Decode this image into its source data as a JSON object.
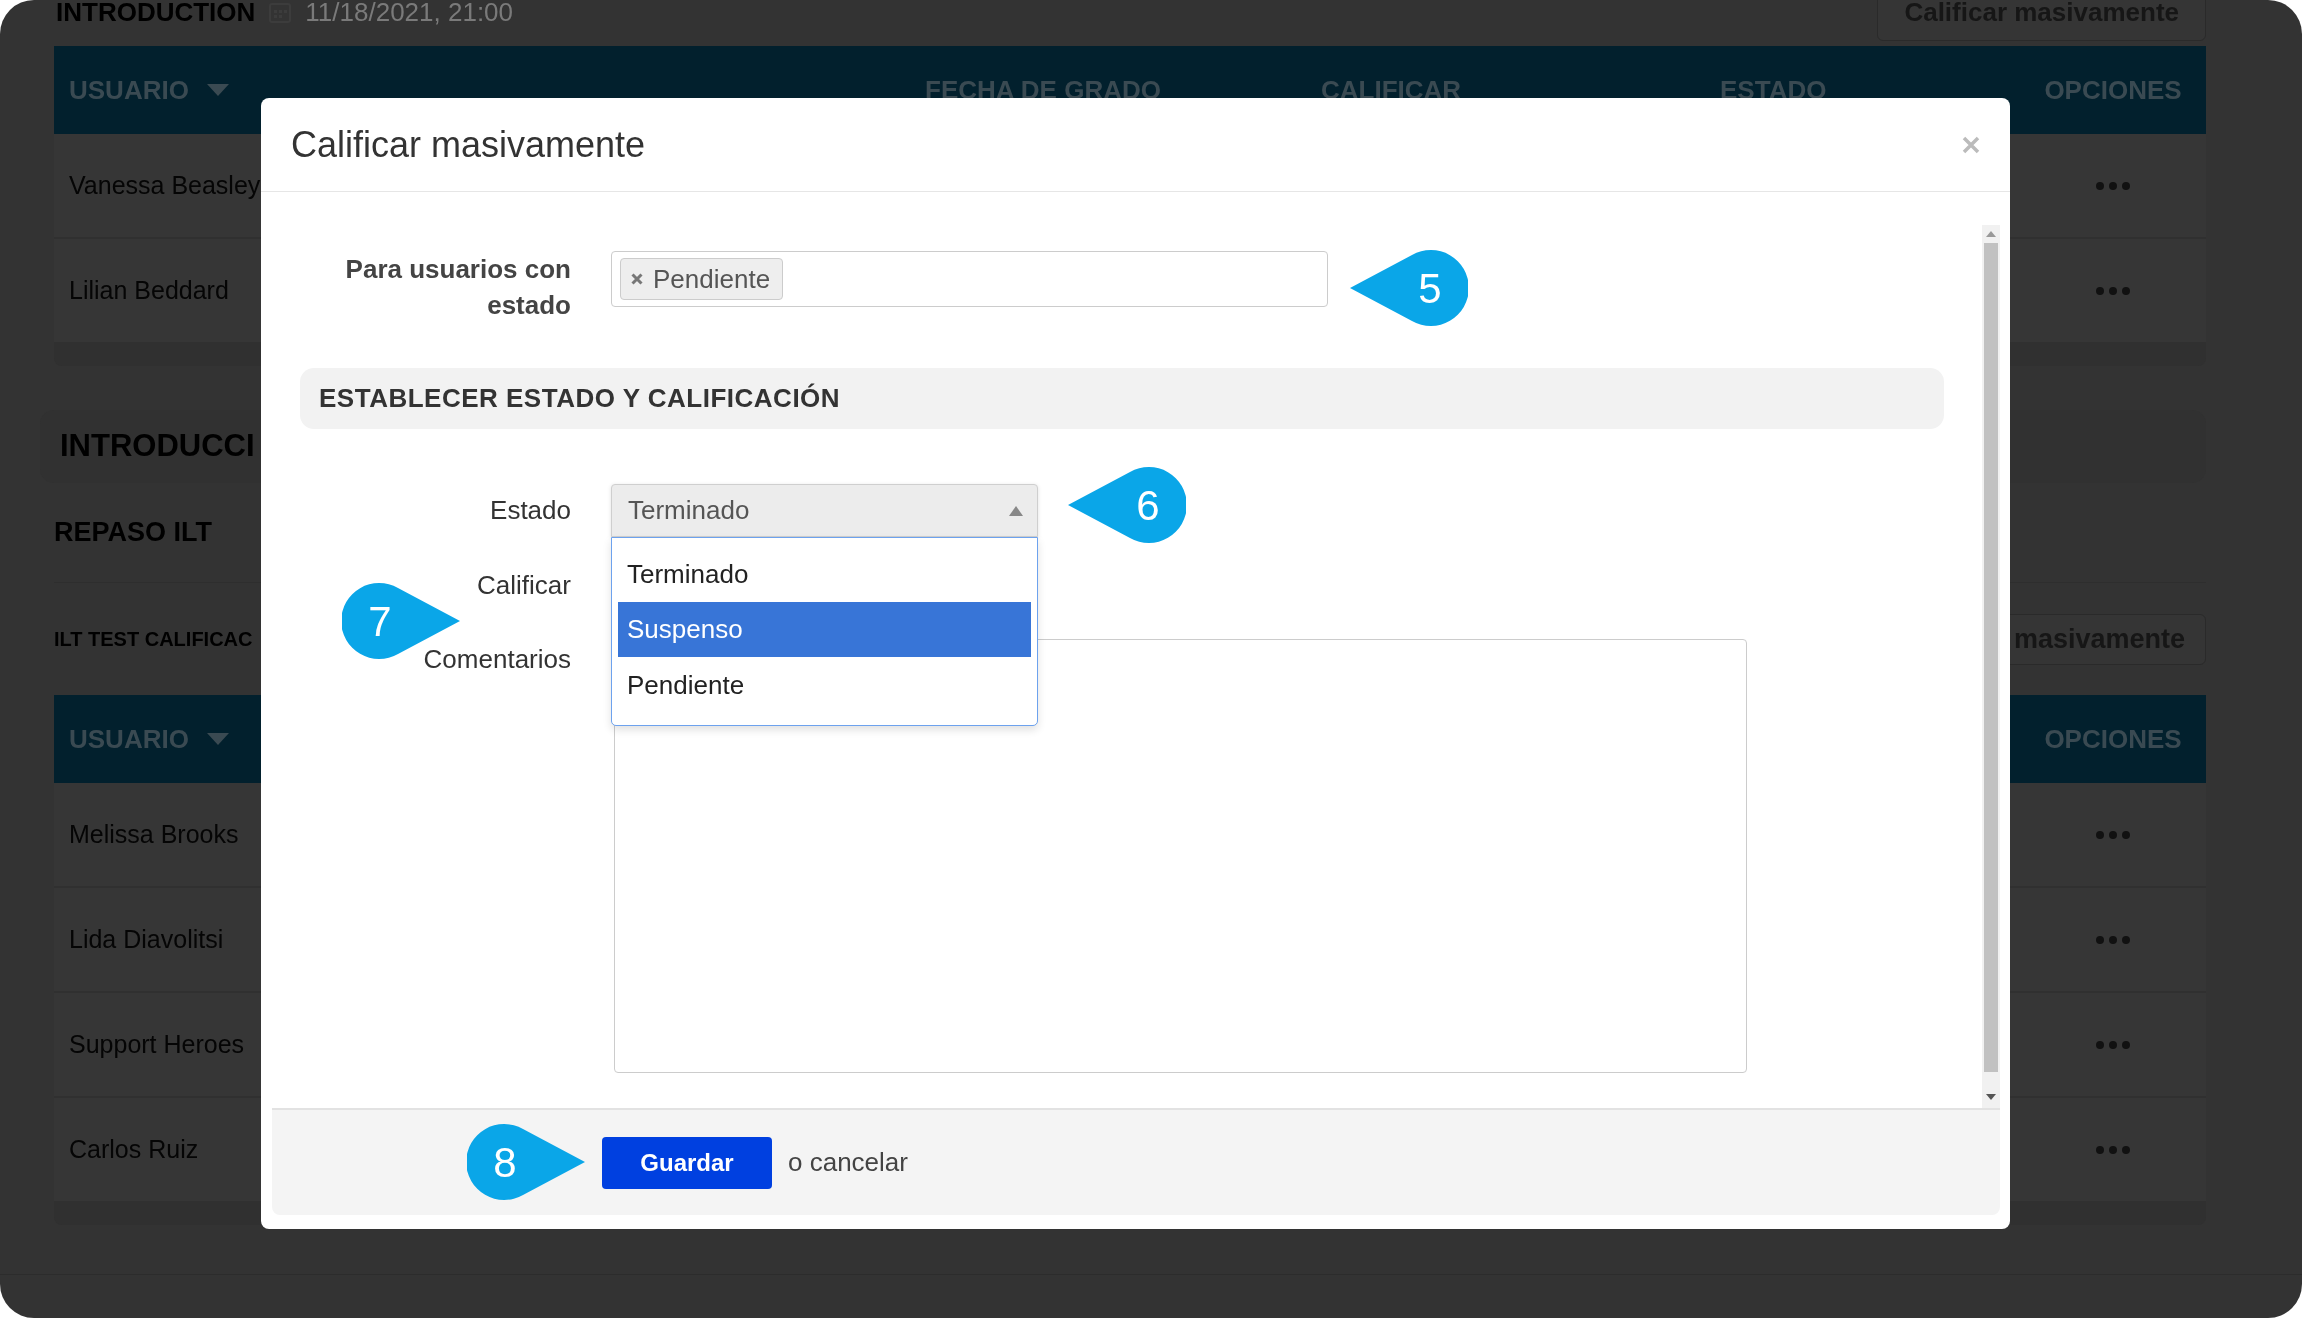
{
  "page": {
    "course_title": "INTRODUCTION",
    "course_date": "11/18/2021, 21:00",
    "bulk_button": "Calificar masivamente",
    "table_1": {
      "columns": [
        {
          "label": "USUARIO",
          "sort_caret": true
        },
        {
          "label": "FECHA DE GRADO",
          "sort_caret": false
        },
        {
          "label": "CALIFICAR",
          "sort_caret": false
        },
        {
          "label": "ESTADO",
          "sort_caret": false
        },
        {
          "label": "OPCIONES",
          "sort_caret": false
        }
      ],
      "rows": [
        "Vanessa Beasley",
        "Lilian Beddard"
      ]
    },
    "section_title": "INTRODUCCI",
    "subsection": "REPASO ILT",
    "activity": "ILT TEST CALIFICAC",
    "bulk_button_2": "masivamente",
    "table_2": {
      "columns": [
        {
          "label": "USUARIO",
          "sort_caret": true
        },
        {
          "label": "OPCIONES",
          "sort_caret": false
        }
      ],
      "rows": [
        "Melissa Brooks",
        "Lida Diavolitsi",
        "Support Heroes",
        "Carlos Ruiz"
      ]
    }
  },
  "modal": {
    "title": "Calificar masivamente",
    "status_filter": {
      "label": "Para usuarios con estado",
      "tags": [
        "Pendiente"
      ]
    },
    "section_header": "ESTABLECER ESTADO Y CALIFICACIÓN",
    "fields": [
      {
        "kind": "select",
        "label": "Estado",
        "value": "Terminado",
        "expanded": true,
        "options": [
          {
            "label": "Terminado",
            "highlighted": false
          },
          {
            "label": "Suspenso",
            "highlighted": true
          },
          {
            "label": "Pendiente",
            "highlighted": false
          }
        ]
      },
      {
        "kind": "covered",
        "label": "Calificar"
      },
      {
        "kind": "textarea",
        "label": "Comentarios"
      }
    ],
    "save_button": "Guardar",
    "cancel_text": "o cancelar"
  },
  "callouts": [
    {
      "number": "5"
    },
    {
      "number": "6"
    },
    {
      "number": "7"
    },
    {
      "number": "8"
    }
  ]
}
